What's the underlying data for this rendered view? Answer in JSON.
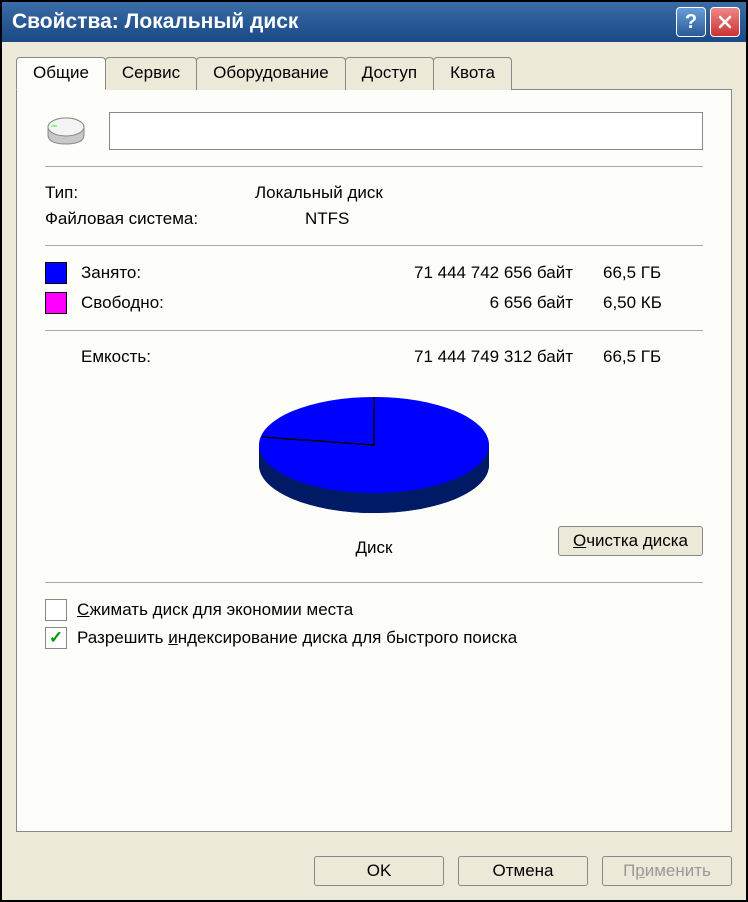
{
  "window": {
    "title": "Свойства: Локальный диск"
  },
  "tabs": {
    "general": "Общие",
    "service": "Сервис",
    "hardware": "Оборудование",
    "sharing": "Доступ",
    "quota": "Квота"
  },
  "header": {
    "volume_label": ""
  },
  "info": {
    "type_label": "Тип:",
    "type_value": "Локальный диск",
    "fs_label": "Файловая система:",
    "fs_value": "NTFS"
  },
  "usage": {
    "used_label": "Занято:",
    "used_bytes": "71 444 742 656 байт",
    "used_human": "66,5 ГБ",
    "free_label": "Свободно:",
    "free_bytes": "6 656 байт",
    "free_human": "6,50 КБ",
    "capacity_label": "Емкость:",
    "capacity_bytes": "71 444 749 312 байт",
    "capacity_human": "66,5 ГБ",
    "used_color": "#0000ff",
    "free_color": "#ff00ff"
  },
  "pie": {
    "disk_label": "Диск",
    "cleanup_button": "Очистка диска"
  },
  "options": {
    "compress": "Сжимать диск для экономии места",
    "compress_checked": false,
    "index": "Разрешить индексирование диска для быстрого поиска",
    "index_checked": true
  },
  "buttons": {
    "ok": "OK",
    "cancel": "Отмена",
    "apply": "Применить"
  },
  "chart_data": {
    "type": "pie",
    "title": "Диск",
    "series": [
      {
        "name": "Занято",
        "value": 71444742656,
        "color": "#0000ff"
      },
      {
        "name": "Свободно",
        "value": 6656,
        "color": "#ff00ff"
      }
    ]
  }
}
